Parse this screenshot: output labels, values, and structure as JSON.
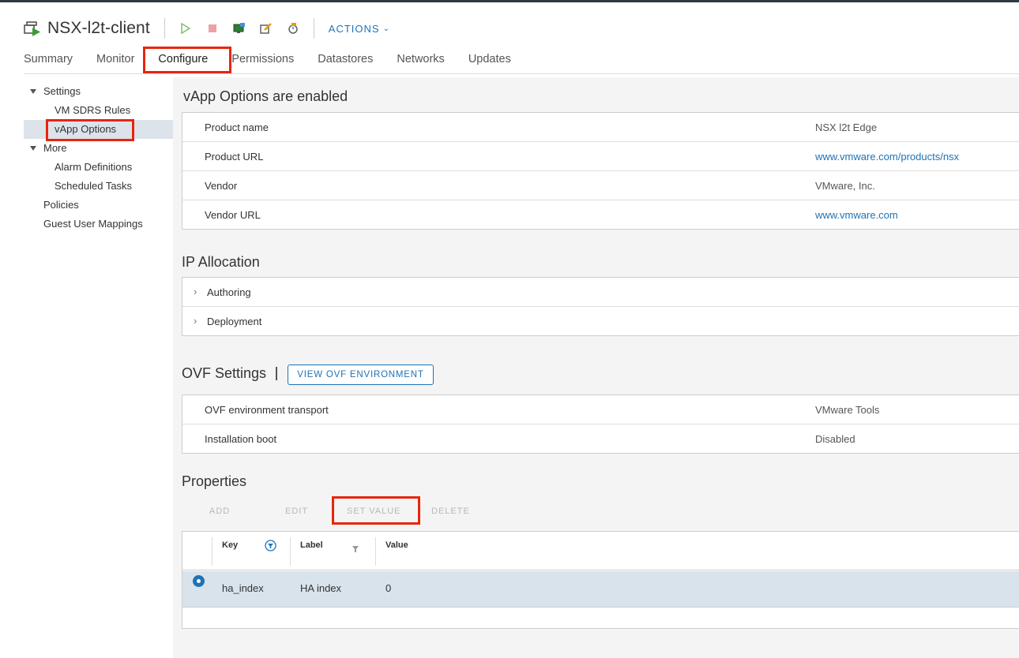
{
  "header": {
    "title": "NSX-l2t-client",
    "actions_label": "ACTIONS",
    "icons": [
      "vm-icon",
      "power-on-icon",
      "power-off-icon",
      "console-icon",
      "edit-settings-icon",
      "snapshot-icon"
    ],
    "accent_color": "#1d73b6"
  },
  "tabs": [
    {
      "label": "Summary"
    },
    {
      "label": "Monitor"
    },
    {
      "label": "Configure",
      "active": true
    },
    {
      "label": "Permissions"
    },
    {
      "label": "Datastores"
    },
    {
      "label": "Networks"
    },
    {
      "label": "Updates"
    }
  ],
  "sidebar": {
    "settings_label": "Settings",
    "vm_sdrs_rules": "VM SDRS Rules",
    "vapp_options": "vApp Options",
    "more_label": "More",
    "alarm_definitions": "Alarm Definitions",
    "scheduled_tasks": "Scheduled Tasks",
    "policies": "Policies",
    "guest_user_mappings": "Guest User Mappings"
  },
  "vapp": {
    "title": "vApp Options are enabled",
    "rows": [
      {
        "key": "Product name",
        "value": "NSX l2t Edge"
      },
      {
        "key": "Product URL",
        "value": "www.vmware.com/products/nsx"
      },
      {
        "key": "Vendor",
        "value": "VMware, Inc."
      },
      {
        "key": "Vendor URL",
        "value": "www.vmware.com"
      }
    ]
  },
  "ip_allocation": {
    "title": "IP Allocation",
    "rows": [
      {
        "label": "Authoring"
      },
      {
        "label": "Deployment"
      }
    ]
  },
  "ovf": {
    "title": "OVF Settings",
    "view_button": "VIEW OVF ENVIRONMENT",
    "rows": [
      {
        "key": "OVF environment transport",
        "value": "VMware Tools"
      },
      {
        "key": "Installation boot",
        "value": "Disabled"
      }
    ]
  },
  "properties": {
    "title": "Properties",
    "buttons": {
      "add": "ADD",
      "edit": "EDIT",
      "set_value": "SET VALUE",
      "delete": "DELETE"
    },
    "columns": {
      "key": "Key",
      "label": "Label",
      "value": "Value"
    },
    "rows": [
      {
        "key": "ha_index",
        "label": "HA index",
        "value": "0",
        "selected": true
      }
    ]
  }
}
